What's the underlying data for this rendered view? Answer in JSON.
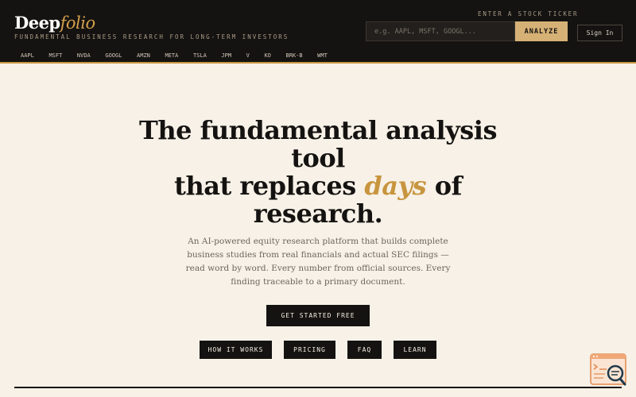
{
  "header": {
    "logo_main": "Deep",
    "logo_accent": "folio",
    "tagline": "FUNDAMENTAL BUSINESS RESEARCH FOR LONG-TERM INVESTORS",
    "ticker_label": "ENTER A STOCK TICKER",
    "ticker_placeholder": "e.g. AAPL, MSFT, GOOGL...",
    "analyze_label": "ANALYZE",
    "signin_label": "Sign In",
    "tickers": [
      "AAPL",
      "MSFT",
      "NVDA",
      "GOOGL",
      "AMZN",
      "META",
      "TSLA",
      "JPM",
      "V",
      "KO",
      "BRK-B",
      "WMT"
    ]
  },
  "hero": {
    "line1": "The fundamental analysis",
    "line2": "tool",
    "line3_pre": "that replaces",
    "line3_accent": "days",
    "line3_post": "of",
    "line4": "research.",
    "subtext": "An AI-powered equity research platform that builds complete business studies from real financials and actual SEC filings — read word by word. Every number from official sources. Every finding traceable to a primary document.",
    "cta_label": "GET STARTED FREE",
    "nav": {
      "how": "HOW IT WORKS",
      "pricing": "PRICING",
      "faq": "FAQ",
      "learn": "LEARN"
    }
  },
  "colors": {
    "accent": "#c8953f",
    "dark": "#151311",
    "background": "#f7f1e7",
    "button_gold": "#d6b176"
  }
}
